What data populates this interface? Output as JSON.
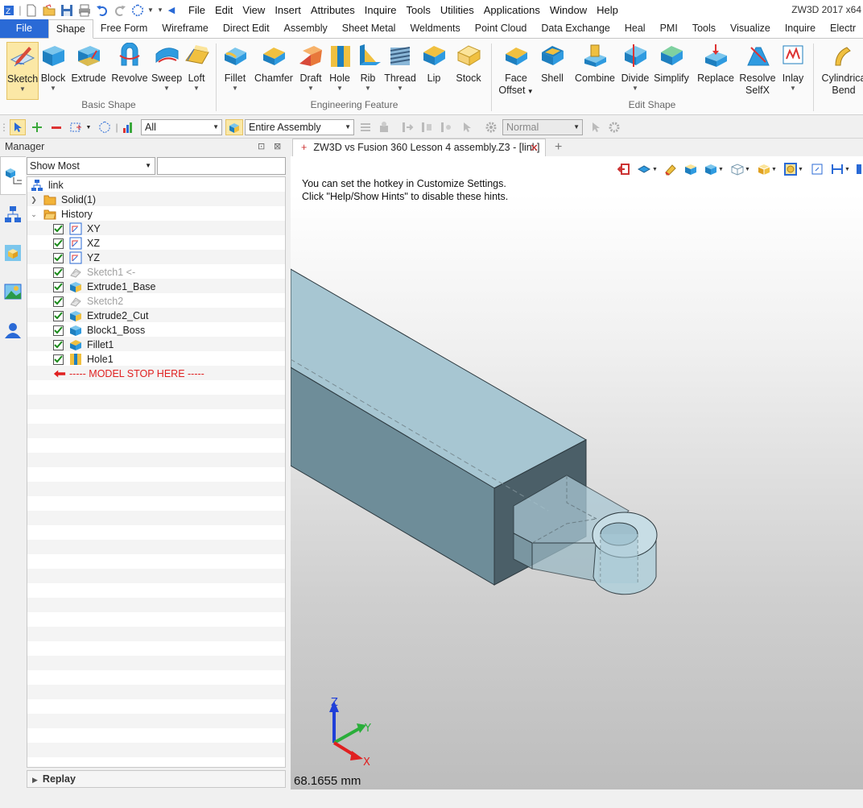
{
  "app": {
    "title": "ZW3D 2017  x64"
  },
  "menu": [
    "File",
    "Edit",
    "View",
    "Insert",
    "Attributes",
    "Inquire",
    "Tools",
    "Utilities",
    "Applications",
    "Window",
    "Help"
  ],
  "ribbon_tabs": [
    "File",
    "Shape",
    "Free Form",
    "Wireframe",
    "Direct Edit",
    "Assembly",
    "Sheet Metal",
    "Weldments",
    "Point Cloud",
    "Data Exchange",
    "Heal",
    "PMI",
    "Tools",
    "Visualize",
    "Inquire",
    "Electr"
  ],
  "active_ribbon_tab": "Shape",
  "ribbon": {
    "basic": {
      "label": "Basic Shape",
      "buttons": [
        {
          "label": "Sketch",
          "icon": "sketch-icon"
        },
        {
          "label": "Block",
          "icon": "block-icon"
        },
        {
          "label": "Extrude",
          "icon": "extrude-icon"
        },
        {
          "label": "Revolve",
          "icon": "revolve-icon"
        },
        {
          "label": "Sweep",
          "icon": "sweep-icon"
        },
        {
          "label": "Loft",
          "icon": "loft-icon"
        }
      ]
    },
    "engineering": {
      "label": "Engineering Feature",
      "buttons": [
        {
          "label": "Fillet",
          "icon": "fillet-icon"
        },
        {
          "label": "Chamfer",
          "icon": "chamfer-icon"
        },
        {
          "label": "Draft",
          "icon": "draft-icon"
        },
        {
          "label": "Hole",
          "icon": "hole-icon"
        },
        {
          "label": "Rib",
          "icon": "rib-icon"
        },
        {
          "label": "Thread",
          "icon": "thread-icon"
        },
        {
          "label": "Lip",
          "icon": "lip-icon"
        },
        {
          "label": "Stock",
          "icon": "stock-icon"
        }
      ]
    },
    "edit": {
      "label": "Edit Shape",
      "buttons": [
        {
          "label": "Face",
          "label2": "Offset",
          "icon": "face-offset-icon"
        },
        {
          "label": "Shell",
          "icon": "shell-icon"
        },
        {
          "label": "Combine",
          "icon": "combine-icon"
        },
        {
          "label": "Divide",
          "icon": "divide-icon"
        },
        {
          "label": "Simplify",
          "icon": "simplify-icon"
        },
        {
          "label": "Replace",
          "icon": "replace-icon"
        },
        {
          "label": "Resolve",
          "label2": "SelfX",
          "icon": "resolve-selfx-icon"
        },
        {
          "label": "Inlay",
          "icon": "inlay-icon"
        },
        {
          "label": "Cylindrica",
          "label2": "Bend",
          "icon": "cylindrical-bend-icon"
        }
      ]
    }
  },
  "toolbar": {
    "filter_value": "All",
    "scope_value": "Entire Assembly",
    "render_value": "Normal"
  },
  "manager": {
    "title": "Manager",
    "filter_select": "Show Most",
    "filter_input": "",
    "root": "link",
    "solid": "Solid(1)",
    "history": "History",
    "items": [
      {
        "label": "XY",
        "icon": "datum-plane-icon",
        "state": "normal"
      },
      {
        "label": "XZ",
        "icon": "datum-plane-icon",
        "state": "normal"
      },
      {
        "label": "YZ",
        "icon": "datum-plane-icon",
        "state": "normal"
      },
      {
        "label": "Sketch1 <-",
        "icon": "sketch-feature-icon",
        "state": "dim"
      },
      {
        "label": "Extrude1_Base",
        "icon": "extrude-feature-icon",
        "state": "normal"
      },
      {
        "label": "Sketch2",
        "icon": "sketch-feature-icon",
        "state": "dim"
      },
      {
        "label": "Extrude2_Cut",
        "icon": "extrude-feature-icon",
        "state": "normal"
      },
      {
        "label": "Block1_Boss",
        "icon": "block-feature-icon",
        "state": "normal"
      },
      {
        "label": "Fillet1",
        "icon": "fillet-feature-icon",
        "state": "normal"
      },
      {
        "label": "Hole1",
        "icon": "hole-feature-icon",
        "state": "normal"
      }
    ],
    "stop_label": "----- MODEL STOP HERE -----",
    "replay": "Replay"
  },
  "document": {
    "tab_title": "ZW3D vs Fusion 360 Lesson 4 assembly.Z3 - [link]",
    "hint_line1": "You can set the hotkey in Customize Settings.",
    "hint_line2": "Click \"Help/Show Hints\" to disable these hints.",
    "measure": "68.1655 mm"
  },
  "triad": {
    "x": "X",
    "y": "Y",
    "z": "Z"
  },
  "colors": {
    "file_tab": "#2a6ad6",
    "model_top": "#a7c6d2",
    "model_side": "#6e8d99",
    "model_front": "#4b5f68",
    "stop_text": "#e02020"
  }
}
